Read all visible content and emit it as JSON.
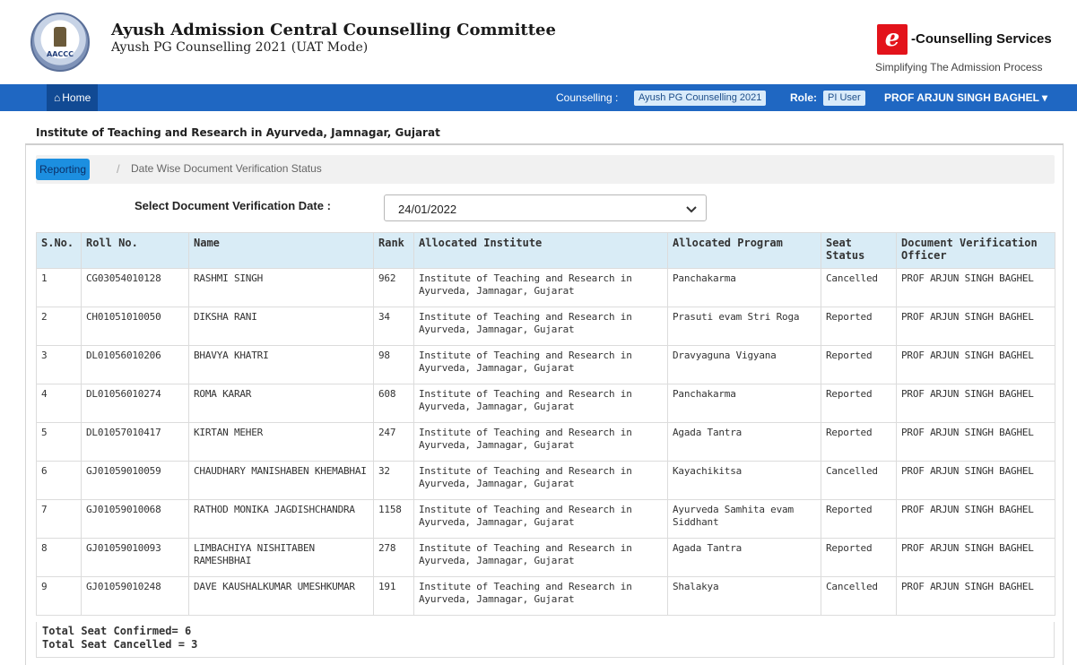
{
  "header": {
    "logo_text": "AACCC",
    "title": "Ayush Admission Central Counselling Committee",
    "subtitle": "Ayush PG Counselling 2021 (UAT Mode)",
    "brand_mark": "e",
    "brand_title": "-Counselling Services",
    "brand_tagline": "Simplifying The Admission Process",
    "brand_color": "#e3131b"
  },
  "nav": {
    "home_label": "Home",
    "home_icon": "home-icon",
    "counselling_label": "Counselling :",
    "counselling_value": "Ayush PG Counselling 2021",
    "role_label": "Role:",
    "role_value": "PI User",
    "user_name": "PROF ARJUN SINGH BAGHEL ▾",
    "bar_color": "#1f67c2"
  },
  "institute_title": "Institute of Teaching and Research in Ayurveda, Jamnagar, Gujarat",
  "breadcrumb": {
    "root": "Reporting",
    "separator": "/",
    "current": "Date Wise Document Verification Status"
  },
  "filter": {
    "label": "Select Document Verification Date :",
    "selected": "24/01/2022"
  },
  "table": {
    "headers": [
      "S.No.",
      "Roll No.",
      "Name",
      "Rank",
      "Allocated Institute",
      "Allocated Program",
      "Seat Status",
      "Document Verification Officer"
    ],
    "rows": [
      [
        "1",
        "CG03054010128",
        "RASHMI SINGH",
        "962",
        "Institute of Teaching and Research in Ayurveda, Jamnagar, Gujarat",
        "Panchakarma",
        "Cancelled",
        "PROF ARJUN SINGH BAGHEL"
      ],
      [
        "2",
        "CH01051010050",
        "DIKSHA RANI",
        "34",
        "Institute of Teaching and Research in Ayurveda, Jamnagar, Gujarat",
        "Prasuti evam Stri Roga",
        "Reported",
        "PROF ARJUN SINGH BAGHEL"
      ],
      [
        "3",
        "DL01056010206",
        "BHAVYA KHATRI",
        "98",
        "Institute of Teaching and Research in Ayurveda, Jamnagar, Gujarat",
        "Dravyaguna Vigyana",
        "Reported",
        "PROF ARJUN SINGH BAGHEL"
      ],
      [
        "4",
        "DL01056010274",
        "ROMA KARAR",
        "608",
        "Institute of Teaching and Research in Ayurveda, Jamnagar, Gujarat",
        "Panchakarma",
        "Reported",
        "PROF ARJUN SINGH BAGHEL"
      ],
      [
        "5",
        "DL01057010417",
        "KIRTAN MEHER",
        "247",
        "Institute of Teaching and Research in Ayurveda, Jamnagar, Gujarat",
        "Agada Tantra",
        "Reported",
        "PROF ARJUN SINGH BAGHEL"
      ],
      [
        "6",
        "GJ01059010059",
        "CHAUDHARY MANISHABEN KHEMABHAI",
        "32",
        "Institute of Teaching and Research in Ayurveda, Jamnagar, Gujarat",
        "Kayachikitsa",
        "Cancelled",
        "PROF ARJUN SINGH BAGHEL"
      ],
      [
        "7",
        "GJ01059010068",
        "RATHOD MONIKA JAGDISHCHANDRA",
        "1158",
        "Institute of Teaching and Research in Ayurveda, Jamnagar, Gujarat",
        "Ayurveda Samhita evam Siddhant",
        "Reported",
        "PROF ARJUN SINGH BAGHEL"
      ],
      [
        "8",
        "GJ01059010093",
        "LIMBACHIYA NISHITABEN RAMESHBHAI",
        "278",
        "Institute of Teaching and Research in Ayurveda, Jamnagar, Gujarat",
        "Agada Tantra",
        "Reported",
        "PROF ARJUN SINGH BAGHEL"
      ],
      [
        "9",
        "GJ01059010248",
        "DAVE KAUSHALKUMAR UMESHKUMAR",
        "191",
        "Institute of Teaching and Research in Ayurveda, Jamnagar, Gujarat",
        "Shalakya",
        "Cancelled",
        "PROF ARJUN SINGH BAGHEL"
      ]
    ]
  },
  "totals": {
    "confirmed": "Total Seat Confirmed= 6",
    "cancelled": "Total Seat Cancelled = 3"
  }
}
